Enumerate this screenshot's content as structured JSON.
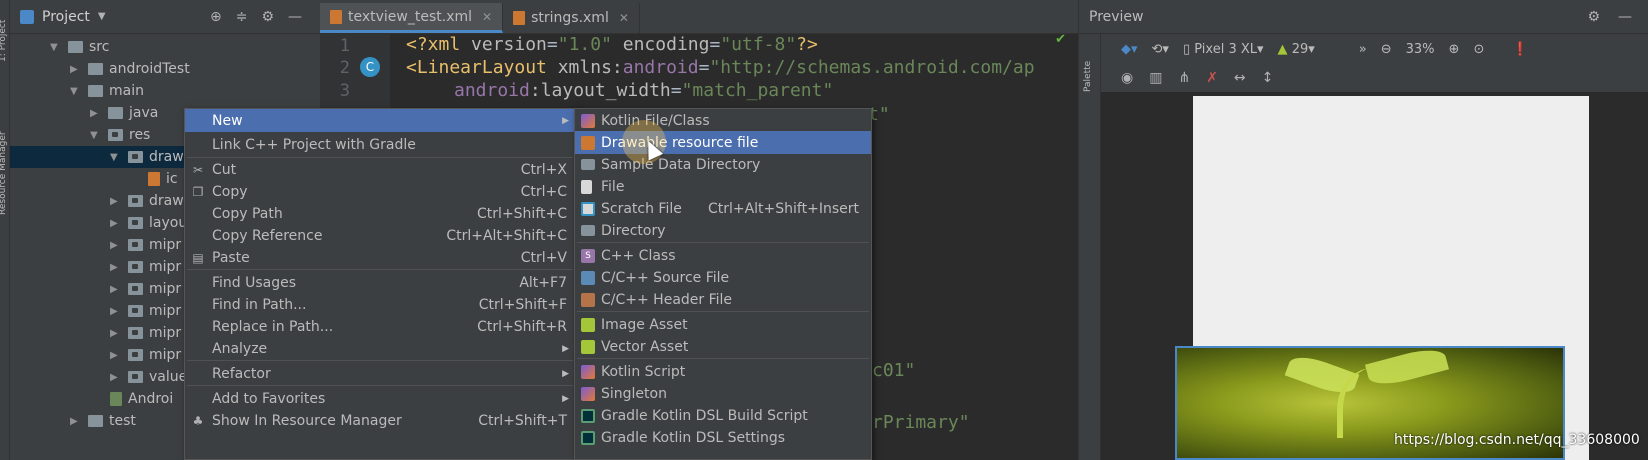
{
  "left_strip": {
    "project_label": "1: Project",
    "resource_label": "Resource Manager"
  },
  "project_panel": {
    "title": "Project",
    "tree": [
      {
        "label": "src",
        "expanded": true
      },
      {
        "label": "androidTest",
        "expanded": false
      },
      {
        "label": "main",
        "expanded": true
      },
      {
        "label": "java",
        "expanded": false
      },
      {
        "label": "res",
        "expanded": true
      },
      {
        "label": "draw",
        "expanded": true
      },
      {
        "label": "ic"
      },
      {
        "label": "draw",
        "expanded": false
      },
      {
        "label": "layou",
        "expanded": false
      },
      {
        "label": "mipr",
        "expanded": false
      },
      {
        "label": "mipr",
        "expanded": false
      },
      {
        "label": "mipr",
        "expanded": false
      },
      {
        "label": "mipr",
        "expanded": false
      },
      {
        "label": "mipr",
        "expanded": false
      },
      {
        "label": "mipr",
        "expanded": false
      },
      {
        "label": "value",
        "expanded": false
      },
      {
        "label": "Androi"
      },
      {
        "label": "test",
        "expanded": false
      }
    ]
  },
  "editor": {
    "tabs": [
      {
        "label": "textview_test.xml",
        "active": true
      },
      {
        "label": "strings.xml",
        "active": false
      }
    ],
    "line_numbers": [
      "1",
      "2",
      "3"
    ],
    "code": {
      "l1_pi_open": "<?xml ",
      "l1_attr1": "version",
      "l1_eq1": "=",
      "l1_val1": "\"1.0\"",
      "l1_attr2": " encoding",
      "l1_eq2": "=",
      "l1_val2": "\"utf-8\"",
      "l1_pi_close": "?>",
      "l2_tag": "<LinearLayout ",
      "l2_attr": "xmlns:",
      "l2_ns": "android",
      "l2_eq": "=",
      "l2_val": "\"http://schemas.android.com/ap",
      "l3_ns": "android",
      "l3_attr": ":layout_width",
      "l3_eq": "=",
      "l3_val": "\"match_parent\"",
      "frag1": "t\"",
      "frag2": "c01\"",
      "frag3": "rPrimary\""
    },
    "gutter_badge": "C"
  },
  "preview": {
    "title": "Preview",
    "palette_label": "Palette",
    "device": "Pixel 3 XL",
    "api": "29",
    "zoom": "33%"
  },
  "context_menu": {
    "items": [
      {
        "label": "New",
        "shortcut": "",
        "submenu": true,
        "highlighted": true,
        "icon": ""
      },
      {
        "label": "Link C++ Project with Gradle",
        "shortcut": "",
        "icon": ""
      },
      {
        "label": "Cut",
        "shortcut": "Ctrl+X",
        "icon": "✂"
      },
      {
        "label": "Copy",
        "shortcut": "Ctrl+C",
        "icon": "❐"
      },
      {
        "label": "Copy Path",
        "shortcut": "Ctrl+Shift+C",
        "icon": ""
      },
      {
        "label": "Copy Reference",
        "shortcut": "Ctrl+Alt+Shift+C",
        "icon": ""
      },
      {
        "label": "Paste",
        "shortcut": "Ctrl+V",
        "icon": "▤"
      },
      {
        "label": "Find Usages",
        "shortcut": "Alt+F7",
        "icon": ""
      },
      {
        "label": "Find in Path...",
        "shortcut": "Ctrl+Shift+F",
        "icon": ""
      },
      {
        "label": "Replace in Path...",
        "shortcut": "Ctrl+Shift+R",
        "icon": ""
      },
      {
        "label": "Analyze",
        "shortcut": "",
        "submenu": true,
        "icon": ""
      },
      {
        "label": "Refactor",
        "shortcut": "",
        "submenu": true,
        "icon": ""
      },
      {
        "label": "Add to Favorites",
        "shortcut": "",
        "submenu": true,
        "icon": ""
      },
      {
        "label": "Show In Resource Manager",
        "shortcut": "Ctrl+Shift+T",
        "icon": "♣"
      }
    ]
  },
  "new_submenu": {
    "items": [
      {
        "label": "Kotlin File/Class",
        "shortcut": "",
        "icon": "kotlin-icon"
      },
      {
        "label": "Drawable resource file",
        "shortcut": "",
        "icon": "xml-icon",
        "highlighted": true
      },
      {
        "label": "Sample Data Directory",
        "shortcut": "",
        "icon": "folder-icon"
      },
      {
        "label": "File",
        "shortcut": "",
        "icon": "file-icon"
      },
      {
        "label": "Scratch File",
        "shortcut": "Ctrl+Alt+Shift+Insert",
        "icon": "scratch-icon"
      },
      {
        "label": "Directory",
        "shortcut": "",
        "icon": "folder-icon"
      },
      {
        "label": "C++ Class",
        "shortcut": "",
        "icon": "s-icon"
      },
      {
        "label": "C/C++ Source File",
        "shortcut": "",
        "icon": "cpp-icon"
      },
      {
        "label": "C/C++ Header File",
        "shortcut": "",
        "icon": "header-icon"
      },
      {
        "label": "Image Asset",
        "shortcut": "",
        "icon": "android-icon"
      },
      {
        "label": "Vector Asset",
        "shortcut": "",
        "icon": "android-icon"
      },
      {
        "label": "Kotlin Script",
        "shortcut": "",
        "icon": "kotlin-icon"
      },
      {
        "label": "Singleton",
        "shortcut": "",
        "icon": "kotlin-icon"
      },
      {
        "label": "Gradle Kotlin DSL Build Script",
        "shortcut": "",
        "icon": "gradle-icon"
      },
      {
        "label": "Gradle Kotlin DSL Settings",
        "shortcut": "",
        "icon": "gradle-icon"
      }
    ]
  },
  "watermark": "https://blog.csdn.net/qq_33608000",
  "colors": {
    "accent": "#4b6eaf",
    "background": "#2b2b2b",
    "panel": "#3c3f41"
  }
}
